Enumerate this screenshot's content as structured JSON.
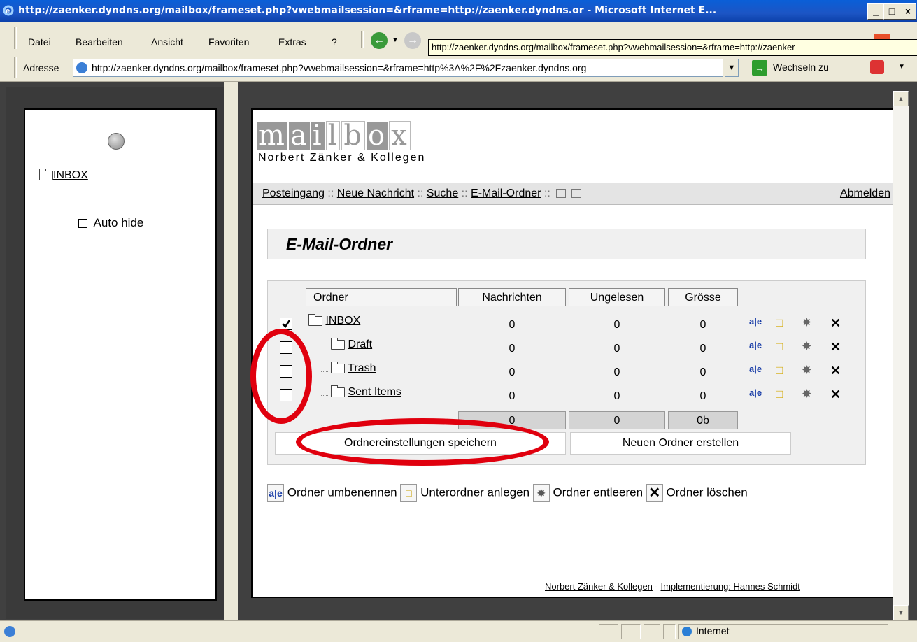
{
  "window": {
    "title": "http://zaenker.dyndns.org/mailbox/frameset.php?vwebmailsession=&rframe=http://zaenker.dyndns.or - Microsoft Internet E...",
    "minimize": "_",
    "maximize": "□",
    "close": "×"
  },
  "menu": {
    "items": [
      "Datei",
      "Bearbeiten",
      "Ansicht",
      "Favoriten",
      "Extras",
      "?"
    ]
  },
  "tooltip": "http://zaenker.dyndns.org/mailbox/frameset.php?vwebmailsession=&rframe=http://zaenker",
  "address": {
    "label": "Adresse",
    "value": "http://zaenker.dyndns.org/mailbox/frameset.php?vwebmailsession=&rframe=http%3A%2F%2Fzaenker.dyndns.org",
    "go_label": "Wechseln zu"
  },
  "left_frame": {
    "inbox_label": "INBOX",
    "autohide_label": "Auto hide"
  },
  "mailbox": {
    "logo_letters": [
      "m",
      "a",
      "i",
      "l",
      "b",
      "o",
      "x"
    ],
    "company": "Norbert Zänker & Kollegen",
    "nav": {
      "inbox": "Posteingang",
      "new_message": "Neue Nachricht",
      "search": "Suche",
      "folders": "E-Mail-Ordner",
      "sep": "::",
      "logout": "Abmelden"
    },
    "section_title": "E-Mail-Ordner",
    "columns": [
      "Ordner",
      "Nachrichten",
      "Ungelesen",
      "Grösse"
    ],
    "folders": [
      {
        "name": "INBOX",
        "messages": "0",
        "unread": "0",
        "size": "0",
        "checked": true,
        "indent": 0
      },
      {
        "name": "Draft",
        "messages": "0",
        "unread": "0",
        "size": "0",
        "checked": false,
        "indent": 1
      },
      {
        "name": "Trash",
        "messages": "0",
        "unread": "0",
        "size": "0",
        "checked": false,
        "indent": 1
      },
      {
        "name": "Sent Items",
        "messages": "0",
        "unread": "0",
        "size": "0",
        "checked": false,
        "indent": 1
      }
    ],
    "totals": {
      "messages": "0",
      "unread": "0",
      "size": "0b"
    },
    "save_button": "Ordnereinstellungen speichern",
    "new_folder_button": "Neuen Ordner erstellen",
    "legend": {
      "rename": "Ordner umbenennen",
      "subfolder": "Unterordner anlegen",
      "empty": "Ordner entleeren",
      "delete": "Ordner löschen"
    },
    "footer_company": "Norbert Zänker & Kollegen",
    "footer_sep": " - ",
    "footer_impl": "Implementierung: Hannes Schmidt"
  },
  "statusbar": {
    "zone": "Internet"
  },
  "colors": {
    "annotation": "#E0000E",
    "titlebar": "#0a5fd8",
    "chrome": "#ECE9D8"
  },
  "icons": {
    "rename": "rename-icon",
    "new_subfolder": "new-subfolder-icon",
    "empty": "empty-folder-icon",
    "delete": "delete-icon"
  }
}
